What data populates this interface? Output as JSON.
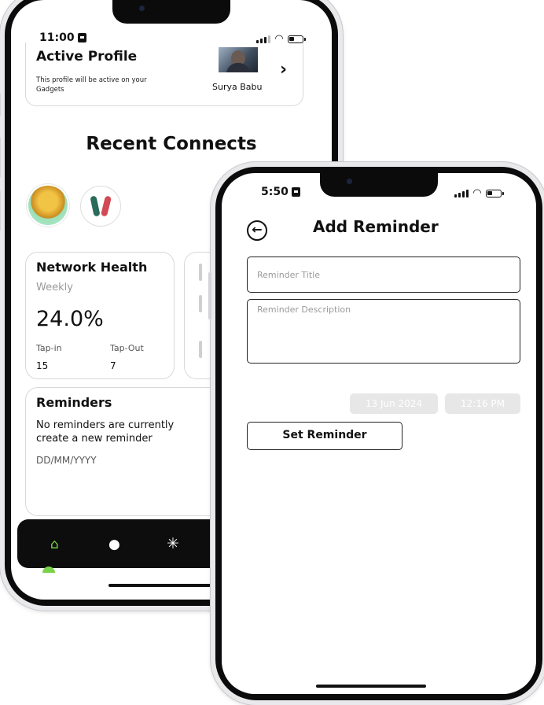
{
  "phone_left": {
    "status": {
      "time": "11:00"
    },
    "active_profile": {
      "title": "Active Profile",
      "description": "This profile will be active on your Gadgets",
      "name": "Surya Babu"
    },
    "recent_connects": {
      "title": "Recent Connects"
    },
    "network_health": {
      "title": "Network Health",
      "period": "Weekly",
      "value": "24.0%",
      "tap_in_label": "Tap-in",
      "tap_out_label": "Tap-Out",
      "tap_in_value": "15",
      "tap_out_value": "7"
    },
    "reminders": {
      "title": "Reminders",
      "message_line1": "No reminders are currently",
      "message_line2": "create a new reminder",
      "date_placeholder": "DD/MM/YYYY"
    },
    "bottom_nav": [
      "home-icon",
      "user-icon",
      "network-icon"
    ],
    "colors": {
      "accent": "#7bd24a",
      "nav_bg": "#0d0d0d"
    }
  },
  "phone_right": {
    "status": {
      "time": "5:50"
    },
    "header": {
      "title": "Add Reminder"
    },
    "form": {
      "title_placeholder": "Reminder Title",
      "description_placeholder": "Reminder Description",
      "date": "13 Jun 2024",
      "time": "12:16 PM",
      "submit_label": "Set Reminder"
    }
  }
}
